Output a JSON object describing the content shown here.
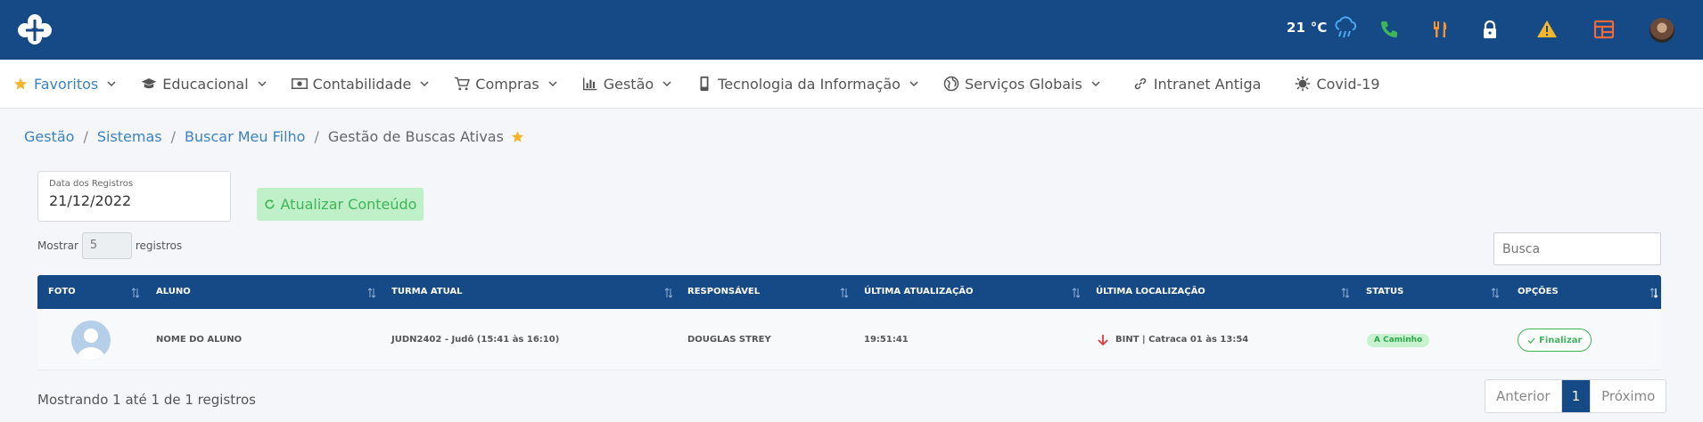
{
  "topbar": {
    "weather": {
      "temp": "21 °C",
      "icon": "rain-cloud-icon"
    },
    "icons": [
      "phone-icon",
      "restaurant-icon",
      "lock-icon",
      "warning-icon",
      "layout-icon"
    ],
    "colors": {
      "bar": "#154a86",
      "phone": "#3fb55a",
      "food": "#f59331",
      "warning": "#f5b62b",
      "layout": "#ef6a3a"
    }
  },
  "nav": {
    "items": [
      {
        "label": "Favoritos",
        "icon": "star-icon"
      },
      {
        "label": "Educacional",
        "icon": "graduation-cap-icon"
      },
      {
        "label": "Contabilidade",
        "icon": "money-icon"
      },
      {
        "label": "Compras",
        "icon": "cart-icon"
      },
      {
        "label": "Gestão",
        "icon": "bar-chart-icon"
      },
      {
        "label": "Tecnologia da Informação",
        "icon": "mobile-icon"
      },
      {
        "label": "Serviços Globais",
        "icon": "globe-icon"
      },
      {
        "label": "Intranet Antiga",
        "icon": "link-icon"
      },
      {
        "label": "Covid-19",
        "icon": "virus-icon"
      }
    ]
  },
  "breadcrumb": {
    "items": [
      "Gestão",
      "Sistemas",
      "Buscar Meu Filho"
    ],
    "current": "Gestão de Buscas Ativas"
  },
  "filters": {
    "date_label": "Data dos Registros",
    "date_value": "21/12/2022",
    "update_button": "Atualizar Conteúdo"
  },
  "list_controls": {
    "show_label": "Mostrar",
    "show_value": "5",
    "records_label": "registros",
    "search_placeholder": "Busca"
  },
  "table": {
    "columns": [
      "FOTO",
      "ALUNO",
      "TURMA ATUAL",
      "RESPONSÁVEL",
      "ÚLTIMA ATUALIZAÇÃO",
      "ÚLTIMA LOCALIZAÇÃO",
      "STATUS",
      "OPÇÕES"
    ],
    "rows": [
      {
        "aluno": "NOME DO ALUNO",
        "turma": "JUDN2402 - Judô (15:41 às 16:10)",
        "responsavel": "DOUGLAS STREY",
        "atualizacao": "19:51:41",
        "localizacao": "BINT | Catraca 01 às 13:54",
        "status": "A Caminho",
        "opcao": "Finalizar"
      }
    ]
  },
  "footer": {
    "info": "Mostrando 1 até 1 de 1 registros",
    "prev": "Anterior",
    "page": "1",
    "next": "Próximo"
  }
}
